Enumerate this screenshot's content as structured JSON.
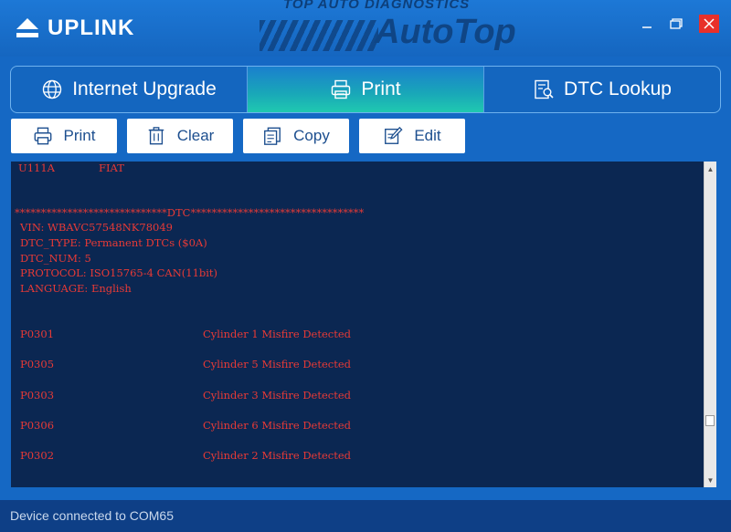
{
  "app": {
    "logo_text": "UPLINK",
    "brand_tagline": "TOP AUTO DIAGNOSTICS",
    "brand_name": "AutoTop"
  },
  "colors": {
    "accent_tab": "#20c9b0",
    "report_bg": "#0b2752",
    "report_text": "#e83a36",
    "close_button": "#e8302a"
  },
  "tabs": [
    {
      "label": "Internet Upgrade",
      "icon": "globe-icon",
      "active": false
    },
    {
      "label": "Print",
      "icon": "printer-icon",
      "active": true
    },
    {
      "label": "DTC Lookup",
      "icon": "document-search-icon",
      "active": false
    }
  ],
  "toolbar": {
    "print_label": "Print",
    "clear_label": "Clear",
    "copy_label": "Copy",
    "edit_label": "Edit"
  },
  "report": {
    "partial_row": {
      "code": "U111A",
      "text": "FIAT"
    },
    "separator": "*****************************DTC*********************************",
    "info": {
      "vin": "VIN: WBAVC57548NK78049",
      "dtc_type": "DTC_TYPE: Permanent DTCs ($0A)",
      "dtc_num": "DTC_NUM: 5",
      "protocol": "PROTOCOL: ISO15765-4 CAN(11bit)",
      "language": "LANGUAGE: English"
    },
    "dtcs": [
      {
        "code": "P0301",
        "description": "Cylinder 1 Misfire Detected"
      },
      {
        "code": "P0305",
        "description": "Cylinder 5 Misfire Detected"
      },
      {
        "code": "P0303",
        "description": "Cylinder 3 Misfire Detected"
      },
      {
        "code": "P0306",
        "description": "Cylinder 6 Misfire Detected"
      },
      {
        "code": "P0302",
        "description": "Cylinder 2 Misfire Detected"
      }
    ]
  },
  "status": {
    "text": "Device connected to COM65"
  }
}
